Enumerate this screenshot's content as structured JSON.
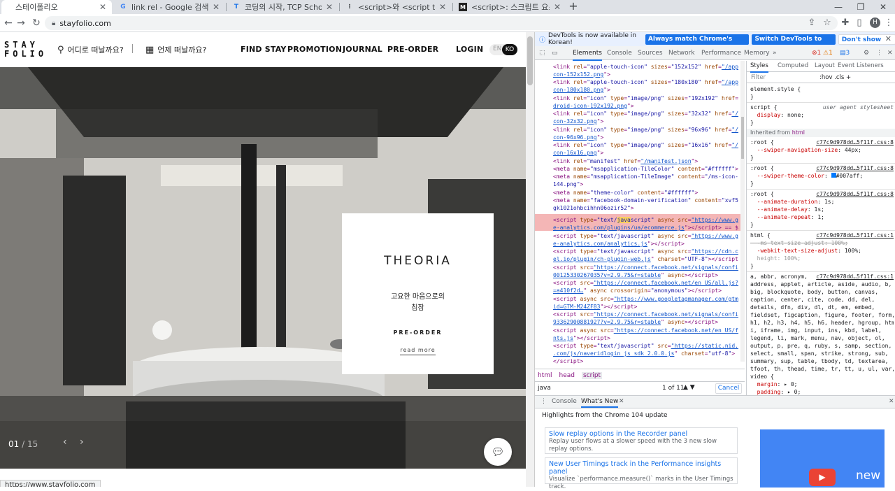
{
  "tabs": [
    {
      "title": "스테이폴리오",
      "favicon": "S",
      "active": true
    },
    {
      "title": "link rel - Google 검색",
      "favicon": "G",
      "active": false
    },
    {
      "title": "코딩의 시작, TCP School",
      "favicon": "T",
      "active": false
    },
    {
      "title": "<script>와 <script type=\"text/ja",
      "favicon": "⁝",
      "active": false
    },
    {
      "title": "<script>: 스크립트 요소 - HTML",
      "favicon": "M",
      "active": false
    }
  ],
  "omnibox": {
    "url": "stayfolio.com"
  },
  "profile_initial": "H",
  "site": {
    "logo": "STAY\nFOLIO",
    "search_where": "어디로 떠날까요?",
    "search_when": "언제 떠날까요?",
    "nav": [
      "FIND STAY",
      "PROMOTION",
      "JOURNAL",
      "PRE-ORDER"
    ],
    "login": "LOGIN",
    "lang_en": "EN",
    "lang_ko": "KO",
    "card": {
      "brand": "THEORIA",
      "desc_line1": "고요한 마음으로의",
      "desc_line2": "침잠",
      "preorder": "PRE-ORDER",
      "more": "read more"
    },
    "slide_current": "01",
    "slide_total": "15",
    "status_url": "https://www.stayfolio.com"
  },
  "devtools": {
    "infobar": {
      "text": "DevTools is now available in Korean!",
      "btn_match": "Always match Chrome's language",
      "btn_switch": "Switch DevTools to Korean",
      "btn_dont": "Don't show again"
    },
    "tabs": [
      "Elements",
      "Console",
      "Sources",
      "Network",
      "Performance",
      "Memory"
    ],
    "badges": {
      "errors": "1",
      "warnings": "1",
      "info": "3"
    },
    "crumbs": [
      "html",
      "head",
      "script"
    ],
    "find": {
      "query": "java",
      "count": "1 of 11",
      "cancel": "Cancel"
    },
    "styles_tabs": [
      "Styles",
      "Computed",
      "Layout",
      "Event Listeners"
    ],
    "filter_placeholder": "Filter",
    "filter_hov": ":hov  .cls  +",
    "drawer_tabs": [
      "Console",
      "What's New"
    ],
    "whatsnew_heading": "Highlights from the Chrome 104 update",
    "whatsnew_items": [
      {
        "title": "Slow replay options in the Recorder panel",
        "desc": "Replay user flows at a slower speed with the 3 new slow replay options."
      },
      {
        "title": "New User Timings track in the Performance insights panel",
        "desc": "Visualize `performance.measure()` marks in the User Timings track."
      }
    ],
    "whatsnew_img_text": "new",
    "colors": {
      "accent": "#1a73e8",
      "highlight": "#f4b6b6",
      "theme": "#007aff"
    }
  }
}
